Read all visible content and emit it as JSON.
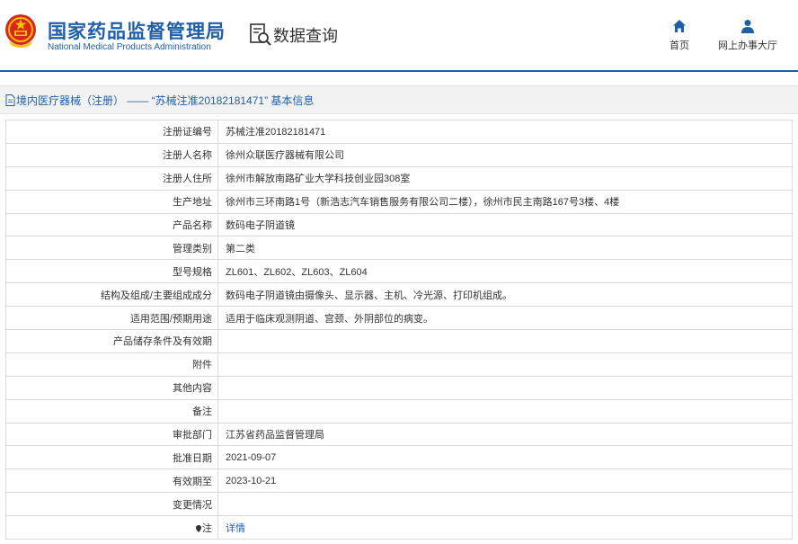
{
  "header": {
    "brand_cn": "国家药品监督管理局",
    "brand_en": "National Medical Products Administration",
    "query_label": "数据查询"
  },
  "nav": {
    "home_label": "首页",
    "hall_label": "网上办事大厅"
  },
  "breadcrumb": {
    "text": "境内医疗器械（注册） —— “苏械注准20182181471”  基本信息"
  },
  "record": {
    "rows": [
      {
        "label": "注册证编号",
        "value": "苏械注准20182181471"
      },
      {
        "label": "注册人名称",
        "value": "徐州众联医疗器械有限公司"
      },
      {
        "label": "注册人住所",
        "value": "徐州市解放南路矿业大学科技创业园308室"
      },
      {
        "label": "生产地址",
        "value": "徐州市三环南路1号（新浩志汽车销售服务有限公司二楼），徐州市民主南路167号3楼、4楼"
      },
      {
        "label": "产品名称",
        "value": "数码电子阴道镜"
      },
      {
        "label": "管理类别",
        "value": "第二类"
      },
      {
        "label": "型号规格",
        "value": "ZL601、ZL602、ZL603、ZL604"
      },
      {
        "label": "结构及组成/主要组成成分",
        "value": "数码电子阴道镜由摄像头、显示器、主机、冷光源、打印机组成。"
      },
      {
        "label": "适用范围/预期用途",
        "value": "适用于临床观测阴道、宫颈、外阴部位的病变。"
      },
      {
        "label": "产品储存条件及有效期",
        "value": ""
      },
      {
        "label": "附件",
        "value": ""
      },
      {
        "label": "其他内容",
        "value": ""
      },
      {
        "label": "备注",
        "value": ""
      },
      {
        "label": "审批部门",
        "value": "江苏省药品监督管理局"
      },
      {
        "label": "批准日期",
        "value": "2021-09-07"
      },
      {
        "label": "有效期至",
        "value": "2023-10-21"
      },
      {
        "label": "变更情况",
        "value": ""
      }
    ],
    "note_label": "注",
    "note_link": "详情"
  },
  "colors": {
    "brand": "#1f5fa8",
    "emblem_red": "#d9261c",
    "emblem_gold": "#f5c400"
  },
  "icons": [
    "national-emblem-icon",
    "data-query-icon",
    "home-icon",
    "user-icon",
    "document-icon",
    "location-pin-icon"
  ]
}
